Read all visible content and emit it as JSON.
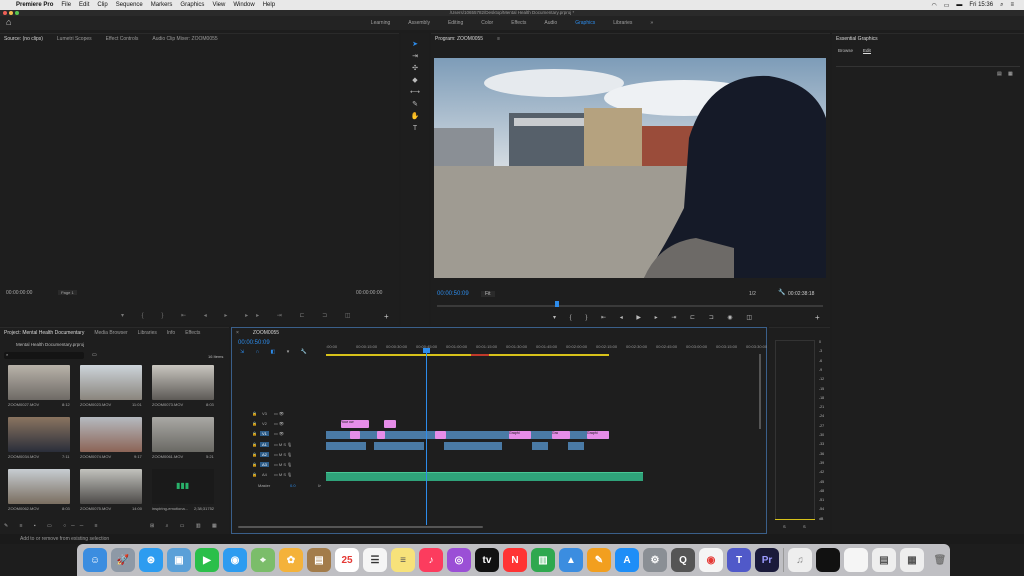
{
  "menubar": {
    "app_name": "Premiere Pro",
    "items": [
      "File",
      "Edit",
      "Clip",
      "Sequence",
      "Markers",
      "Graphics",
      "View",
      "Window",
      "Help"
    ],
    "clock": "Fri 15:36"
  },
  "titlebar": {
    "path": "/Users/10655782/Desktop/Mental Health Documentary.prproj *"
  },
  "workspaces": {
    "items": [
      "Learning",
      "Assembly",
      "Editing",
      "Color",
      "Effects",
      "Audio",
      "Graphics",
      "Libraries"
    ],
    "active": "Graphics"
  },
  "source_panel": {
    "tabs": [
      "Source: (no clips)",
      "Lumetri Scopes",
      "Effect Controls",
      "Audio Clip Mixer: ZOOM0055"
    ],
    "timecode_left": "00:00:00:00",
    "fit_label": "Page 1",
    "timecode_right": "00:00:00:00"
  },
  "program_panel": {
    "title": "Program: ZOOM0055",
    "timecode": "00:00:50:09",
    "fit": "Fit",
    "quality": "1/2",
    "duration": "00:02:38:18"
  },
  "essential_graphics": {
    "title": "Essential Graphics",
    "tabs": [
      "Browse",
      "Edit"
    ],
    "active_tab": "Edit"
  },
  "project_panel": {
    "tabs": [
      "Project: Mental Health Documentary",
      "Media Browser",
      "Libraries",
      "Info",
      "Effects"
    ],
    "project_file": "Mental Health Documentary.prproj",
    "item_count": "16 Items",
    "clips": [
      {
        "name": "ZOOM0027.MOV",
        "duration": "8:12"
      },
      {
        "name": "ZOOM0023.MOV",
        "duration": "11:01"
      },
      {
        "name": "ZOOM0073.MOV",
        "duration": "8:03"
      },
      {
        "name": "ZOOM0034.MOV",
        "duration": "7:11"
      },
      {
        "name": "ZOOM0074.MOV",
        "duration": "9:17"
      },
      {
        "name": "ZOOM0061.MOV",
        "duration": "5:21"
      },
      {
        "name": "ZOOM0062.MOV",
        "duration": "8:03"
      },
      {
        "name": "ZOOM0075.MOV",
        "duration": "14:00"
      },
      {
        "name": "inspiring-emotiona...",
        "duration": "2;38;31752"
      }
    ]
  },
  "timeline": {
    "sequence": "ZOOM0055",
    "timecode": "00:00:50:09",
    "ruler": [
      ":00:00",
      "00:00:15:00",
      "00:00:30:00",
      "00:00:45:00",
      "00:01:00:00",
      "00:01:15:00",
      "00:01:30:00",
      "00:01:45:00",
      "00:02:00:00",
      "00:02:15:00",
      "00:02:30:00",
      "00:02:45:00",
      "00:03:00:00",
      "00:03:15:00",
      "00:03:30:00"
    ],
    "video_tracks": [
      "V3",
      "V2",
      "V1"
    ],
    "audio_tracks": [
      "A1",
      "A2",
      "A3",
      "A4"
    ],
    "master": "Master",
    "master_value": "0.0",
    "graphic_labels": [
      "Your ow",
      "Graphi",
      "Gra",
      "Graphi"
    ]
  },
  "meter": {
    "scale": [
      "0",
      "-3",
      "-6",
      "-9",
      "-12",
      "-15",
      "-18",
      "-21",
      "-24",
      "-27",
      "-30",
      "-33",
      "-36",
      "-39",
      "-42",
      "-45",
      "-48",
      "-51",
      "-54",
      "dB"
    ],
    "solo": [
      "S",
      "S"
    ]
  },
  "statusbar": {
    "text": "Add to or remove from existing selection"
  },
  "colors": {
    "accent": "#2d8ceb",
    "graphic_clip": "#e68de8",
    "video_clip": "#4a7aa5",
    "audio_clip": "#2fa37a",
    "playhead": "#2d8ceb",
    "work_area": "#d7c21a"
  }
}
